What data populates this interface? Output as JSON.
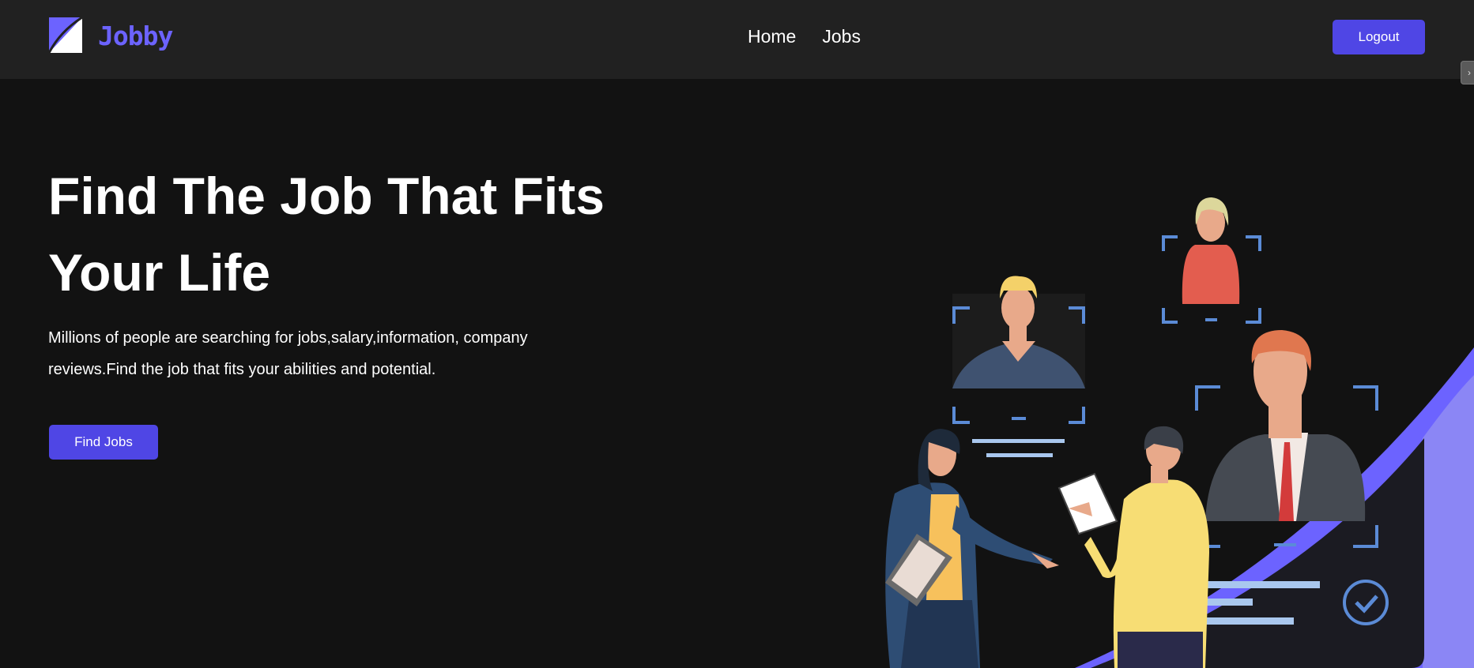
{
  "header": {
    "brand": "Jobby",
    "logo_icon": "jobby-logo-icon",
    "nav": [
      {
        "label": "Home"
      },
      {
        "label": "Jobs"
      }
    ],
    "logout_label": "Logout"
  },
  "hero": {
    "title_line1": "Find The Job That Fits",
    "title_line2": "Your Life",
    "description_line1": "Millions of people are searching for jobs,salary,information, company",
    "description_line2": "reviews.Find the job that fits your abilities and potential.",
    "cta_label": "Find Jobs"
  },
  "colors": {
    "accent": "#4f46e5",
    "brand": "#6c63ff",
    "navbar": "#212121",
    "background": "#121212"
  },
  "illustration": {
    "icon": "hiring-team-illustration"
  }
}
